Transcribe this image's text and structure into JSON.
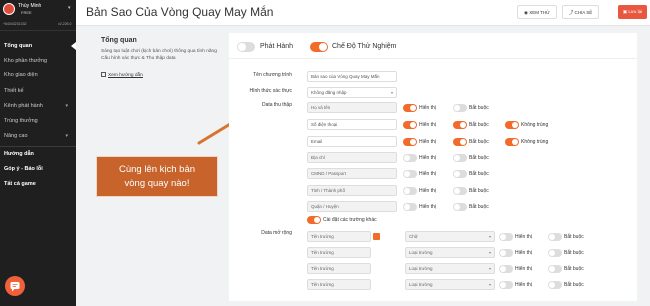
{
  "user": {
    "name": "Thùy Minh",
    "plan": "FREE",
    "phone": "+84343231332",
    "version": "v2.225.0"
  },
  "sidebar": {
    "items": [
      {
        "label": "Tổng quan"
      },
      {
        "label": "Kho phần thưởng"
      },
      {
        "label": "Kho giao diện"
      },
      {
        "label": "Thiết kế"
      },
      {
        "label": "Kênh phát hành"
      },
      {
        "label": "Trúng thưởng"
      },
      {
        "label": "Nâng cao"
      },
      {
        "label": "Hướng dẫn"
      },
      {
        "label": "Góp ý - Báo lỗi"
      },
      {
        "label": "Tất cả game"
      }
    ]
  },
  "header": {
    "title": "Bản Sao Của Vòng Quay May Mắn",
    "view_label": "XEM THỬ",
    "share_label": "CHIA SẺ",
    "save_label": "Lưu lại"
  },
  "intro": {
    "title": "Tổng quan",
    "description": "Sáng tạo luật chơi (kịch bản chơi) thông qua tính năng Cấu hình xác thực & Thu thập data",
    "guide_link": "Xem hướng dẫn"
  },
  "banner": {
    "line1": "Cùng lên kịch bản",
    "line2": "vòng quay nào!"
  },
  "panel": {
    "publish_label": "Phát Hành",
    "test_mode_label": "Chế Độ Thử Nghiệm",
    "program_name_label": "Tên chương trình",
    "program_name_value": "Bản sao của Vòng Quay May Mắn",
    "auth_label": "Hình thức xác thực",
    "auth_value": "Không đăng nhập",
    "data_collect_label": "Data thu thập",
    "show_label": "Hiển thị",
    "required_label": "Bắt buộc",
    "unique_label": "Không trùng",
    "collect_fields": [
      {
        "name": "Họ và tên"
      },
      {
        "name": "Số điện thoại"
      },
      {
        "name": "Email"
      },
      {
        "name": "Địa chỉ"
      },
      {
        "name": "CMND / Passport"
      },
      {
        "name": "Tỉnh / Thành phố"
      },
      {
        "name": "Quận / Huyện"
      }
    ],
    "custom_fields_label": "Cài đặt các trường khác",
    "extended_label": "Data mở rộng",
    "extended_rows": [
      {
        "name": "Tên trường",
        "type": "Chữ"
      },
      {
        "name": "Tên trường",
        "type": "Loại trường"
      },
      {
        "name": "Tên trường",
        "type": "Loại trường"
      },
      {
        "name": "Tên trường",
        "type": "Loại trường"
      }
    ]
  },
  "colors": {
    "accent": "#f26b2b",
    "banner": "#c8632b",
    "sidebar": "#1f1f1f",
    "save_button": "#e9573f"
  }
}
